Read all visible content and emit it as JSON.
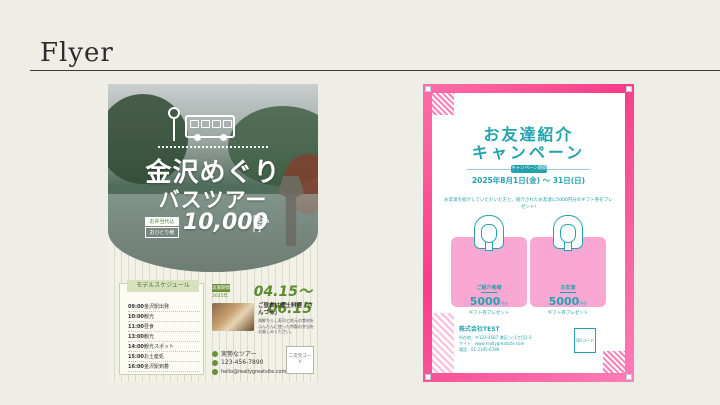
{
  "slide": {
    "title": "Flyer"
  },
  "flyer_bus_tour": {
    "title_line1": "金沢めぐり",
    "title_line2": "バスツアー",
    "badge_top": "お弁当代込",
    "badge_bottom": "おひとり様",
    "price": "10,000",
    "price_unit": "税込円",
    "schedule": {
      "heading": "モデルスケジュール",
      "items": [
        {
          "time": "09:00",
          "place": "金沢駅出発"
        },
        {
          "time": "10:00",
          "place": "観光"
        },
        {
          "time": "11:00",
          "place": "昼食"
        },
        {
          "time": "13:00",
          "place": "観光"
        },
        {
          "time": "14:00",
          "place": "観光スポット"
        },
        {
          "time": "15:00",
          "place": "お土産処"
        },
        {
          "time": "16:00",
          "place": "金沢駅到着"
        }
      ]
    },
    "period_tag": "実施期間",
    "year": "2025年",
    "dates": "04.15～06.15",
    "dish": {
      "heading": "ご昼食は郷土料理「さんづる」",
      "description": "海鮮ちらし寿司と地元の食材をふんだんに使った特製お弁当をお楽しみください。"
    },
    "contact": {
      "org": "実勢なツアー",
      "phone": "123-456-7890",
      "email": "hello@reallygreatsite.com"
    },
    "qr_label": "二次元コード"
  },
  "flyer_referral": {
    "title_line1": "お友達紹介",
    "title_line2": "キャンペーン",
    "period_tag": "キャンペーン期間",
    "date": "2025年8月1日(金) ～ 31日(日)",
    "description": "お友達を紹介していただいた方と、紹介されたお友達に5000円分のギフト券をプレゼント!",
    "cards": [
      {
        "label": "ご紹介者様",
        "amount": "5000",
        "unit": "円分",
        "gift": "ギフト券プレゼント"
      },
      {
        "label": "お友達",
        "amount": "5000",
        "unit": "円分",
        "gift": "ギフト券プレゼント"
      }
    ],
    "company": "株式会社TEST",
    "info_lines": [
      "所在地：〒123-4567 港区○○1丁目2-3",
      "サイト：www.reallygreatsite.com",
      "電話：01-2345-6789"
    ],
    "qr_label": "QRコード"
  }
}
